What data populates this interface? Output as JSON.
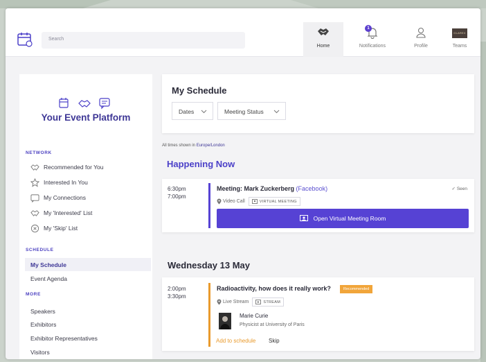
{
  "search": {
    "placeholder": "Search"
  },
  "nav": {
    "home": "Home",
    "notifications": "Notifications",
    "notification_count": "1",
    "profile": "Profile",
    "teams": "Teams",
    "teams_logo_text": "GLAREX"
  },
  "sidebar": {
    "brand": "Your Event Platform",
    "network_heading": "NETWORK",
    "network_items": [
      {
        "label": "Recommended for You",
        "icon": "handshake-icon"
      },
      {
        "label": "Interested In You",
        "icon": "star-icon"
      },
      {
        "label": "My Connections",
        "icon": "chat-icon"
      },
      {
        "label": "My 'Interested' List",
        "icon": "handshake-icon"
      },
      {
        "label": "My 'Skip' List",
        "icon": "close-circle-icon"
      }
    ],
    "schedule_heading": "SCHEDULE",
    "schedule_items": [
      "My Schedule",
      "Event Agenda"
    ],
    "more_heading": "MORE",
    "more_items": [
      "Speakers",
      "Exhibitors",
      "Exhibitor Representatives",
      "Visitors"
    ]
  },
  "schedule": {
    "title": "My Schedule",
    "filter_dates": "Dates",
    "filter_status": "Meeting Status",
    "timezone_prefix": "All times shown in",
    "timezone": "Europe/London"
  },
  "happening_now": {
    "heading": "Happening Now",
    "start": "6:30pm",
    "end": "7:00pm",
    "title": "Meeting: Mark Zuckerberg",
    "company": "(Facebook)",
    "seen": "Seen",
    "location": "Video Call",
    "tag": "VIRTUAL MEETING",
    "button": "Open Virtual Meeting Room"
  },
  "day": {
    "heading": "Wednesday 13 May",
    "start": "2:00pm",
    "end": "3:30pm",
    "title": "Radioactivity, how does it really work?",
    "badge": "Recommended",
    "location": "Live Stream",
    "tag": "STREAM",
    "speaker_name": "Marie Curie",
    "speaker_role": "Physicist at University of Paris",
    "add_label": "Add to schedule",
    "skip_label": "Skip"
  },
  "colors": {
    "brand": "#3e3796",
    "accent": "#5642d4",
    "recommended": "#f1a53a",
    "event_bar": "#e99a2c"
  }
}
